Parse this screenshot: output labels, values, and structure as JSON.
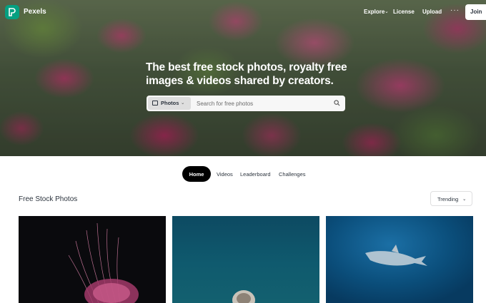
{
  "nav": {
    "brand": "Pexels",
    "explore": "Explore",
    "license": "License",
    "upload": "Upload",
    "more": "···",
    "join": "Join"
  },
  "hero": {
    "headline": "The best free stock photos, royalty free images & videos shared by creators."
  },
  "search": {
    "type_label": "Photos",
    "placeholder": "Search for free photos"
  },
  "tabs": [
    {
      "label": "Home",
      "active": true
    },
    {
      "label": "Videos",
      "active": false
    },
    {
      "label": "Leaderboard",
      "active": false
    },
    {
      "label": "Challenges",
      "active": false
    }
  ],
  "section": {
    "title": "Free Stock Photos",
    "sort_label": "Trending"
  },
  "colors": {
    "brand": "#05a081",
    "text": "#2c343e",
    "active_tab": "#000000"
  },
  "icons": [
    "pexels-logo-icon",
    "chevron-down-icon",
    "more-icon",
    "photo-icon",
    "search-icon"
  ]
}
